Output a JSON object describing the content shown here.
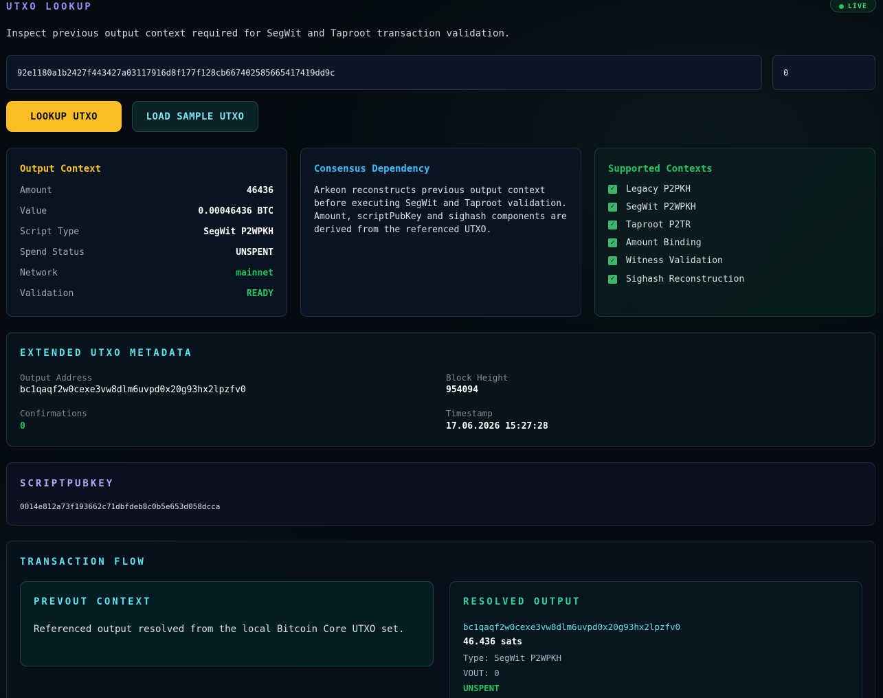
{
  "header": {
    "title": "UTXO LOOKUP",
    "live_badge": "LIVE",
    "subtitle": "Inspect previous output context required for SegWit and Taproot transaction validation."
  },
  "lookup": {
    "txid_value": "92e1180a1b2427f443427a03117916d8f177f128cb6674025856654174 19dd9c",
    "vout_value": "0",
    "lookup_button": "LOOKUP UTXO",
    "sample_button": "LOAD SAMPLE UTXO"
  },
  "output_context": {
    "title": "Output Context",
    "rows": [
      {
        "label": "Amount",
        "value": "46436"
      },
      {
        "label": "Value",
        "value": "0.00046436 BTC"
      },
      {
        "label": "Script Type",
        "value": "SegWit P2WPKH"
      },
      {
        "label": "Spend Status",
        "value": "UNSPENT"
      },
      {
        "label": "Network",
        "value": "mainnet"
      },
      {
        "label": "Validation",
        "value": "READY"
      }
    ]
  },
  "consensus": {
    "title": "Consensus Dependency",
    "text": "Arkeon reconstructs previous output context before executing SegWit and Taproot validation. Amount, scriptPubKey and sighash components are derived from the referenced UTXO."
  },
  "supported": {
    "title": "Supported Contexts",
    "items": [
      "Legacy P2PKH",
      "SegWit P2WPKH",
      "Taproot P2TR",
      "Amount Binding",
      "Witness Validation",
      "Sighash Reconstruction"
    ]
  },
  "extended": {
    "title": "EXTENDED UTXO METADATA",
    "output_address_label": "Output Address",
    "output_address": "bc1qaqf2w0cexe3vw8dlm6uvpd0x20g93hx2lpzfv0",
    "block_height_label": "Block Height",
    "block_height": "954094",
    "confirmations_label": "Confirmations",
    "confirmations": "0",
    "timestamp_label": "Timestamp",
    "timestamp": "17.06.2026 15:27:28"
  },
  "scriptpubkey": {
    "title": "SCRIPTPUBKEY",
    "value": "0014e812a73f193662c71dbfdeb8c0b5e653d058dcca"
  },
  "flow": {
    "title": "TRANSACTION FLOW",
    "prevout_title": "PREVOUT CONTEXT",
    "prevout_text": "Referenced output resolved from the local Bitcoin Core UTXO set.",
    "resolved_title": "RESOLVED OUTPUT",
    "resolved_address": "bc1qaqf2w0cexe3vw8dlm6uvpd0x20g93hx2lpzfv0",
    "resolved_amount": "46.436 sats",
    "resolved_type": "Type: SegWit P2WPKH",
    "resolved_vout": "VOUT: 0",
    "resolved_status": "UNSPENT"
  },
  "colors": {
    "accent_yellow": "#fbbf24",
    "accent_cyan": "#5ee0ee",
    "accent_green": "#22c55e",
    "accent_purple": "#9b8cf5",
    "accent_blue": "#38bdf8"
  }
}
